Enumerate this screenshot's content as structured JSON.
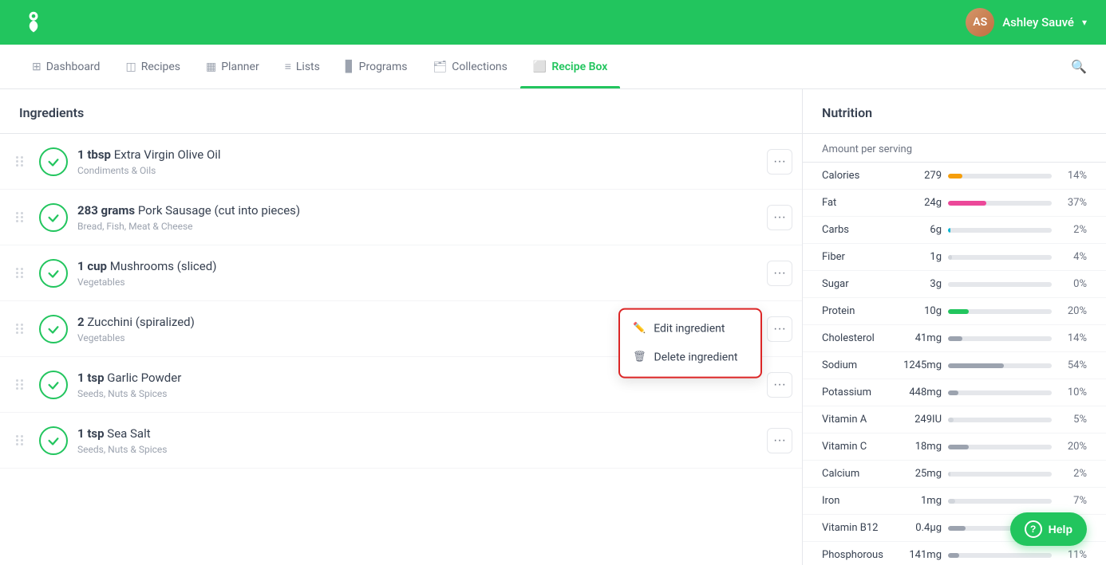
{
  "header": {
    "username": "Ashley Sauvé",
    "logo_alt": "app-logo"
  },
  "nav": {
    "items": [
      {
        "label": "Dashboard",
        "icon": "⊞",
        "active": false,
        "name": "dashboard"
      },
      {
        "label": "Recipes",
        "icon": "◫",
        "active": false,
        "name": "recipes"
      },
      {
        "label": "Planner",
        "icon": "📅",
        "active": false,
        "name": "planner"
      },
      {
        "label": "Lists",
        "icon": "≡",
        "active": false,
        "name": "lists"
      },
      {
        "label": "Programs",
        "icon": "▊",
        "active": false,
        "name": "programs"
      },
      {
        "label": "Collections",
        "icon": "🗂",
        "active": false,
        "name": "collections"
      },
      {
        "label": "Recipe Box",
        "icon": "🟩",
        "active": true,
        "name": "recipe-box"
      }
    ]
  },
  "ingredients_panel": {
    "title": "Ingredients",
    "rows": [
      {
        "id": 1,
        "quantity": "1 tbsp",
        "name": "Extra Virgin Olive Oil",
        "category": "Condiments & Oils",
        "checked": true
      },
      {
        "id": 2,
        "quantity": "283 grams",
        "name": "Pork Sausage (cut into pieces)",
        "category": "Bread, Fish, Meat & Cheese",
        "checked": true
      },
      {
        "id": 3,
        "quantity": "1 cup",
        "name": "Mushrooms (sliced)",
        "category": "Vegetables",
        "checked": true
      },
      {
        "id": 4,
        "quantity": "2",
        "name": "Zucchini (spiralized)",
        "category": "Vegetables",
        "checked": true,
        "show_dropdown": true
      },
      {
        "id": 5,
        "quantity": "1 tsp",
        "name": "Garlic Powder",
        "category": "Seeds, Nuts & Spices",
        "checked": true
      },
      {
        "id": 6,
        "quantity": "1 tsp",
        "name": "Sea Salt",
        "category": "Seeds, Nuts & Spices",
        "checked": true
      }
    ]
  },
  "dropdown_menu": {
    "items": [
      {
        "label": "Edit ingredient",
        "icon": "✏️",
        "name": "edit-ingredient"
      },
      {
        "label": "Delete ingredient",
        "icon": "🗑",
        "name": "delete-ingredient"
      }
    ]
  },
  "nutrition_panel": {
    "title": "Nutrition",
    "amount_label": "Amount per serving",
    "items": [
      {
        "name": "Calories",
        "value": "279",
        "unit": "",
        "bar_pct": 14,
        "bar_color": "#f59e0b",
        "pct": "14%"
      },
      {
        "name": "Fat",
        "value": "24g",
        "unit": "",
        "bar_pct": 37,
        "bar_color": "#ec4899",
        "pct": "37%"
      },
      {
        "name": "Carbs",
        "value": "6g",
        "unit": "",
        "bar_pct": 2,
        "bar_color": "#06b6d4",
        "pct": "2%"
      },
      {
        "name": "Fiber",
        "value": "1g",
        "unit": "",
        "bar_pct": 4,
        "bar_color": "#d1d5db",
        "pct": "4%"
      },
      {
        "name": "Sugar",
        "value": "3g",
        "unit": "",
        "bar_pct": 0,
        "bar_color": "#d1d5db",
        "pct": "0%"
      },
      {
        "name": "Protein",
        "value": "10g",
        "unit": "",
        "bar_pct": 20,
        "bar_color": "#22c55e",
        "pct": "20%"
      },
      {
        "name": "Cholesterol",
        "value": "41mg",
        "unit": "",
        "bar_pct": 14,
        "bar_color": "#9ca3af",
        "pct": "14%"
      },
      {
        "name": "Sodium",
        "value": "1245mg",
        "unit": "",
        "bar_pct": 54,
        "bar_color": "#9ca3af",
        "pct": "54%"
      },
      {
        "name": "Potassium",
        "value": "448mg",
        "unit": "",
        "bar_pct": 10,
        "bar_color": "#9ca3af",
        "pct": "10%"
      },
      {
        "name": "Vitamin A",
        "value": "249IU",
        "unit": "",
        "bar_pct": 5,
        "bar_color": "#d1d5db",
        "pct": "5%"
      },
      {
        "name": "Vitamin C",
        "value": "18mg",
        "unit": "",
        "bar_pct": 20,
        "bar_color": "#9ca3af",
        "pct": "20%"
      },
      {
        "name": "Calcium",
        "value": "25mg",
        "unit": "",
        "bar_pct": 2,
        "bar_color": "#d1d5db",
        "pct": "2%"
      },
      {
        "name": "Iron",
        "value": "1mg",
        "unit": "",
        "bar_pct": 7,
        "bar_color": "#d1d5db",
        "pct": "7%"
      },
      {
        "name": "Vitamin B12",
        "value": "0.4μg",
        "unit": "",
        "bar_pct": 17,
        "bar_color": "#9ca3af",
        "pct": "17%"
      },
      {
        "name": "Phosphorous",
        "value": "141mg",
        "unit": "",
        "bar_pct": 11,
        "bar_color": "#9ca3af",
        "pct": "11%"
      }
    ]
  },
  "help_button": {
    "label": "Help"
  },
  "colors": {
    "green": "#22c55e",
    "border_red": "#dc2626"
  }
}
